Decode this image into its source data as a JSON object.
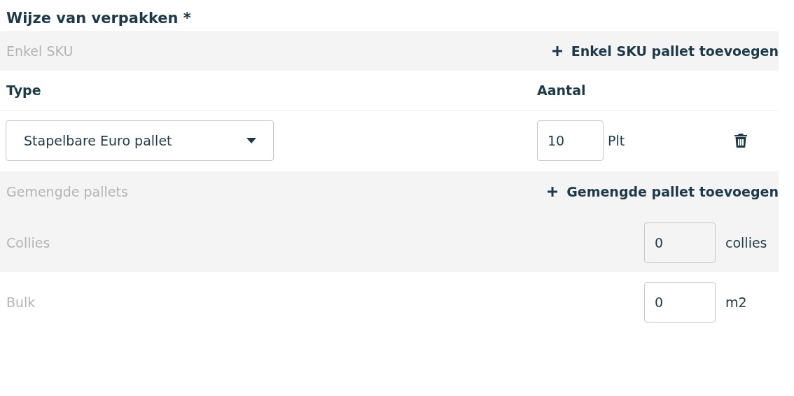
{
  "title": "Wijze van verpakken *",
  "single_sku": {
    "label": "Enkel SKU",
    "add_button": "Enkel SKU pallet toevoegen",
    "columns": [
      "Type",
      "Aantal"
    ],
    "rows": [
      {
        "type": "Stapelbare Euro pallet",
        "amount": "10",
        "unit": "Plt"
      }
    ]
  },
  "mixed": {
    "label": "Gemengde pallets",
    "add_button": "Gemengde pallet toevoegen"
  },
  "quantities": [
    {
      "label": "Collies",
      "value": "0",
      "unit": "collies"
    },
    {
      "label": "Bulk",
      "value": "0",
      "unit": "m2"
    }
  ]
}
